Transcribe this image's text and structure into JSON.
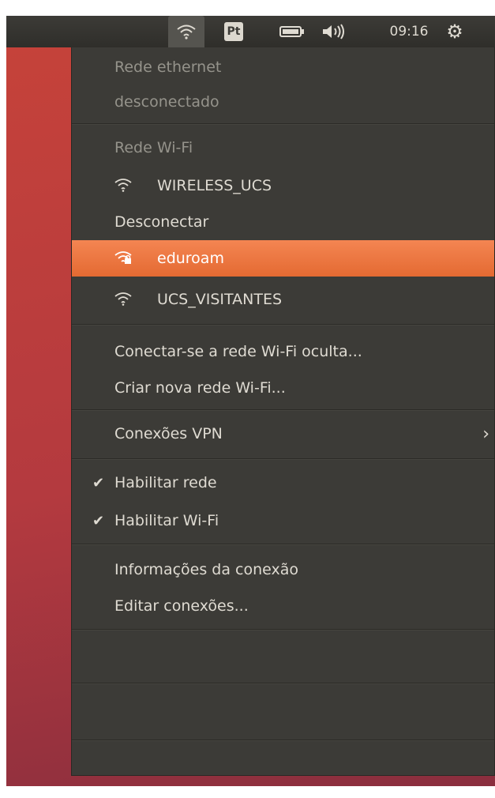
{
  "topbar": {
    "lang": "Pt",
    "clock": "09:16",
    "icons": [
      "wifi-icon",
      "battery-icon",
      "volume-icon",
      "gear-icon"
    ]
  },
  "menu": {
    "ethernet_header": "Rede ethernet",
    "ethernet_status": "desconectado",
    "wifi_header": "Rede Wi-Fi",
    "connected_network": "WIRELESS_UCS",
    "disconnect": "Desconectar",
    "networks": [
      {
        "name": "eduroam",
        "secured": true,
        "highlighted": true
      },
      {
        "name": "UCS_VISITANTES",
        "secured": false,
        "highlighted": false
      }
    ],
    "hidden_network": "Conectar-se a rede Wi-Fi oculta...",
    "create_network": "Criar nova rede Wi-Fi...",
    "vpn": "Conexões VPN",
    "enable_network": "Habilitar rede",
    "enable_network_checked": true,
    "enable_wifi": "Habilitar Wi-Fi",
    "enable_wifi_checked": true,
    "connection_info": "Informações da conexão",
    "edit_connections": "Editar conexões..."
  },
  "colors": {
    "menu_bg": "#3c3b37",
    "highlight": "#e8703a",
    "text": "#dfdbd2",
    "header_text": "#95938b",
    "desktop": "#b43a3f"
  }
}
